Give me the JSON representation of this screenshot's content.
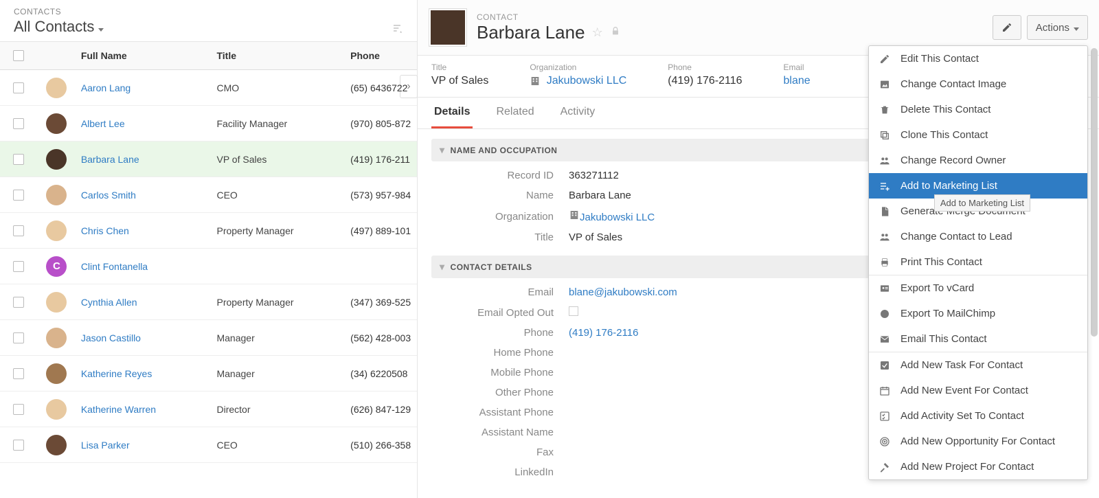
{
  "left": {
    "super": "CONTACTS",
    "title": "All Contacts",
    "columns": {
      "name": "Full Name",
      "title": "Title",
      "phone": "Phone"
    }
  },
  "contacts": [
    {
      "name": "Aaron Lang",
      "title": "CMO",
      "phone": "(65) 6436722",
      "avatarBg": "#e8c9a0"
    },
    {
      "name": "Albert Lee",
      "title": "Facility Manager",
      "phone": "(970) 805-872",
      "avatarBg": "#6b4a36"
    },
    {
      "name": "Barbara Lane",
      "title": "VP of Sales",
      "phone": "(419) 176-211",
      "avatarBg": "#4a3528",
      "selected": true
    },
    {
      "name": "Carlos Smith",
      "title": "CEO",
      "phone": "(573) 957-984",
      "avatarBg": "#d9b38c"
    },
    {
      "name": "Chris Chen",
      "title": "Property Manager",
      "phone": "(497) 889-101",
      "avatarBg": "#e8c9a0"
    },
    {
      "name": "Clint Fontanella",
      "title": "",
      "phone": "",
      "avatarBg": "#b84fc9",
      "initial": "C"
    },
    {
      "name": "Cynthia Allen",
      "title": "Property Manager",
      "phone": "(347) 369-525",
      "avatarBg": "#e8c9a0"
    },
    {
      "name": "Jason Castillo",
      "title": "Manager",
      "phone": "(562) 428-003",
      "avatarBg": "#d9b38c"
    },
    {
      "name": "Katherine Reyes",
      "title": "Manager",
      "phone": "(34) 6220508",
      "avatarBg": "#a07850"
    },
    {
      "name": "Katherine Warren",
      "title": "Director",
      "phone": "(626) 847-129",
      "avatarBg": "#e8c9a0"
    },
    {
      "name": "Lisa Parker",
      "title": "CEO",
      "phone": "(510) 266-358",
      "avatarBg": "#6b4a36"
    }
  ],
  "detail": {
    "super": "CONTACT",
    "name": "Barbara Lane",
    "actions_label": "Actions",
    "summary": {
      "title_label": "Title",
      "title_value": "VP of Sales",
      "org_label": "Organization",
      "org_value": "Jakubowski LLC",
      "phone_label": "Phone",
      "phone_value": "(419) 176-2116",
      "email_label": "Email",
      "email_value": "blane"
    },
    "tabs": {
      "details": "Details",
      "related": "Related",
      "activity": "Activity"
    },
    "section_name": "NAME AND OCCUPATION",
    "section_contact": "CONTACT DETAILS",
    "fields": {
      "record_id_l": "Record ID",
      "record_id_v": "363271112",
      "name_l": "Name",
      "name_v": "Barbara Lane",
      "org_l": "Organization",
      "org_v": "Jakubowski LLC",
      "title_l": "Title",
      "title_v": "VP of Sales",
      "email_l": "Email",
      "email_v": "blane@jakubowski.com",
      "opted_l": "Email Opted Out",
      "phone_l": "Phone",
      "phone_v": "(419) 176-2116",
      "home_l": "Home Phone",
      "mobile_l": "Mobile Phone",
      "other_l": "Other Phone",
      "assist_p_l": "Assistant Phone",
      "assist_n_l": "Assistant Name",
      "fax_l": "Fax",
      "linkedin_l": "LinkedIn"
    },
    "side_org": "Jakubowski LLC"
  },
  "menu": {
    "edit": "Edit This Contact",
    "image": "Change Contact Image",
    "delete": "Delete This Contact",
    "clone": "Clone This Contact",
    "owner": "Change Record Owner",
    "marketing": "Add to Marketing List",
    "merge": "Generate Merge Document",
    "lead": "Change Contact to Lead",
    "print": "Print This Contact",
    "vcard": "Export To vCard",
    "mailchimp": "Export To MailChimp",
    "email": "Email This Contact",
    "task": "Add New Task For Contact",
    "event": "Add New Event For Contact",
    "activity": "Add Activity Set To Contact",
    "opp": "Add New Opportunity For Contact",
    "project": "Add New Project For Contact"
  },
  "tooltip": "Add to Marketing List"
}
